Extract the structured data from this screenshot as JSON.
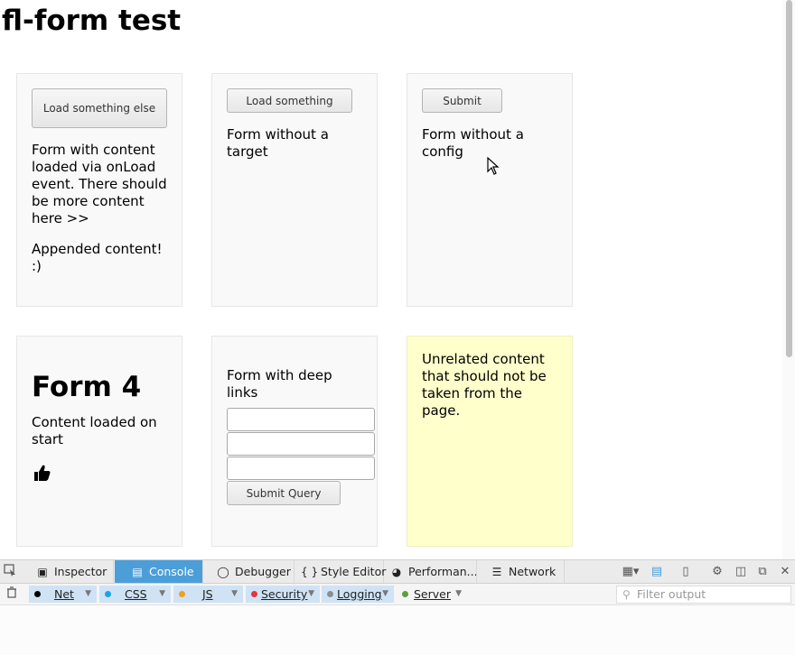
{
  "page": {
    "title": "fl-form test"
  },
  "cards": {
    "card1": {
      "button": "Load something else",
      "text": "Form with content loaded via onLoad event. There should be more content here >>",
      "appended": "Appended content! :)"
    },
    "card2": {
      "button": "Load something",
      "text": "Form without a target"
    },
    "card3": {
      "button": "Submit",
      "text": "Form without a config"
    },
    "card4": {
      "heading": "Form 4",
      "text": "Content loaded on start",
      "icon": "thumbs-up-icon"
    },
    "card5": {
      "text": "Form with deep links",
      "fields": [
        "",
        "",
        ""
      ],
      "submit": "Submit Query"
    },
    "card6": {
      "text": "Unrelated content that should not be taken from the page."
    }
  },
  "devtools": {
    "tabs": [
      {
        "label": "Inspector",
        "icon": "inspector-icon"
      },
      {
        "label": "Console",
        "icon": "console-icon",
        "active": true
      },
      {
        "label": "Debugger",
        "icon": "debugger-icon"
      },
      {
        "label": "Style Editor",
        "icon": "braces-icon"
      },
      {
        "label": "Performan...",
        "icon": "performance-icon"
      },
      {
        "label": "Network",
        "icon": "network-icon"
      }
    ],
    "filters": [
      {
        "label": "Net",
        "color": "#000000"
      },
      {
        "label": "CSS",
        "color": "#1da2e5"
      },
      {
        "label": "JS",
        "color": "#f0a020"
      },
      {
        "label": "Security",
        "color": "#e2373b"
      },
      {
        "label": "Logging",
        "color": "#8d8d8d"
      },
      {
        "label": "Server",
        "color": "#5aa23c"
      }
    ],
    "filter_placeholder": "Filter output"
  },
  "colors": {
    "accent": "#4c9ed9",
    "note": "#ffffcc"
  }
}
